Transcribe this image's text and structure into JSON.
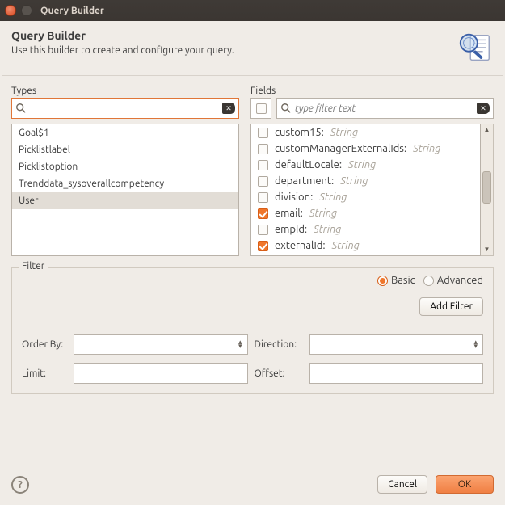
{
  "window": {
    "title": "Query Builder"
  },
  "header": {
    "title": "Query Builder",
    "subtitle": "Use this builder to create and configure your query."
  },
  "types": {
    "label": "Types",
    "search_placeholder": "",
    "items": [
      {
        "label": "Goal$1",
        "selected": false
      },
      {
        "label": "Picklistlabel",
        "selected": false
      },
      {
        "label": "Picklistoption",
        "selected": false
      },
      {
        "label": "Trenddata_sysoverallcompetency",
        "selected": false
      },
      {
        "label": "User",
        "selected": true
      }
    ]
  },
  "fields": {
    "label": "Fields",
    "search_placeholder": "type filter text",
    "items": [
      {
        "name": "custom15",
        "type": "String",
        "checked": false
      },
      {
        "name": "customManagerExternalIds",
        "type": "String",
        "checked": false
      },
      {
        "name": "defaultLocale",
        "type": "String",
        "checked": false
      },
      {
        "name": "department",
        "type": "String",
        "checked": false
      },
      {
        "name": "division",
        "type": "String",
        "checked": false
      },
      {
        "name": "email",
        "type": "String",
        "checked": true
      },
      {
        "name": "empId",
        "type": "String",
        "checked": false
      },
      {
        "name": "externalId",
        "type": "String",
        "checked": true
      }
    ]
  },
  "filter": {
    "label": "Filter",
    "basic_label": "Basic",
    "advanced_label": "Advanced",
    "mode": "basic",
    "add_filter_label": "Add Filter",
    "orderby_label": "Order By:",
    "direction_label": "Direction:",
    "limit_label": "Limit:",
    "offset_label": "Offset:",
    "orderby_value": "",
    "direction_value": "",
    "limit_value": "",
    "offset_value": ""
  },
  "footer": {
    "cancel": "Cancel",
    "ok": "OK"
  }
}
